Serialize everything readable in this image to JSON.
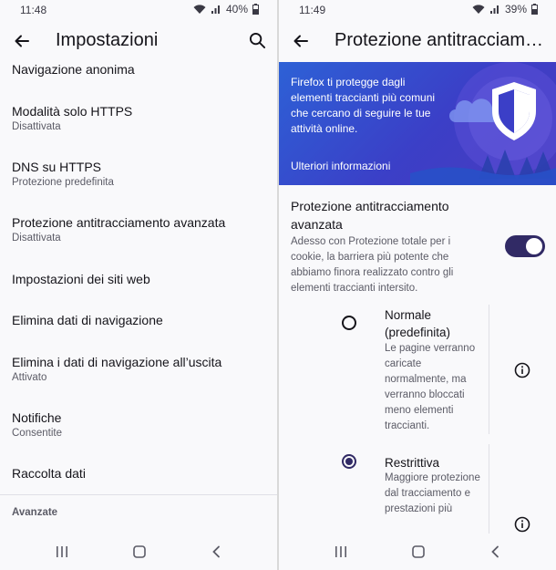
{
  "left": {
    "status": {
      "time": "11:48",
      "battery": "40%"
    },
    "header": {
      "title": "Impostazioni"
    },
    "items": [
      {
        "title": "Navigazione anonima",
        "subtitle": ""
      },
      {
        "title": "Modalità solo HTTPS",
        "subtitle": "Disattivata"
      },
      {
        "title": "DNS su HTTPS",
        "subtitle": "Protezione predefinita"
      },
      {
        "title": "Protezione antitracciamento avanzata",
        "subtitle": "Disattivata"
      },
      {
        "title": "Impostazioni dei siti web",
        "subtitle": ""
      },
      {
        "title": "Elimina dati di navigazione",
        "subtitle": ""
      },
      {
        "title": "Elimina i dati di navigazione all’uscita",
        "subtitle": "Attivato"
      },
      {
        "title": "Notifiche",
        "subtitle": "Consentite"
      },
      {
        "title": "Raccolta dati",
        "subtitle": ""
      }
    ],
    "section_header": "Avanzate"
  },
  "right": {
    "status": {
      "time": "11:49",
      "battery": "39%"
    },
    "header": {
      "title": "Protezione antitracciamento avanzata"
    },
    "banner": {
      "text": "Firefox ti protegge dagli elementi traccianti più comuni che cercano di seguire le tue attività online.",
      "link": "Ulteriori informazioni"
    },
    "etp": {
      "title": "Protezione antitracciamento avanzata",
      "description": "Adesso con Protezione totale per i cookie, la barriera più potente che abbiamo finora realizzato contro gli elementi traccianti intersito.",
      "enabled": true
    },
    "options": [
      {
        "title": "Normale (predefinita)",
        "description": "Le pagine verranno caricate normalmente, ma verranno bloccati meno elementi traccianti.",
        "selected": false
      },
      {
        "title": "Restrittiva",
        "description": "Maggiore protezione dal tracciamento e prestazioni più",
        "selected": true
      }
    ]
  },
  "colors": {
    "accent": "#312a65",
    "banner_blue": "#2d61d6",
    "text_primary": "#15141a",
    "text_secondary": "#5b5b66"
  }
}
